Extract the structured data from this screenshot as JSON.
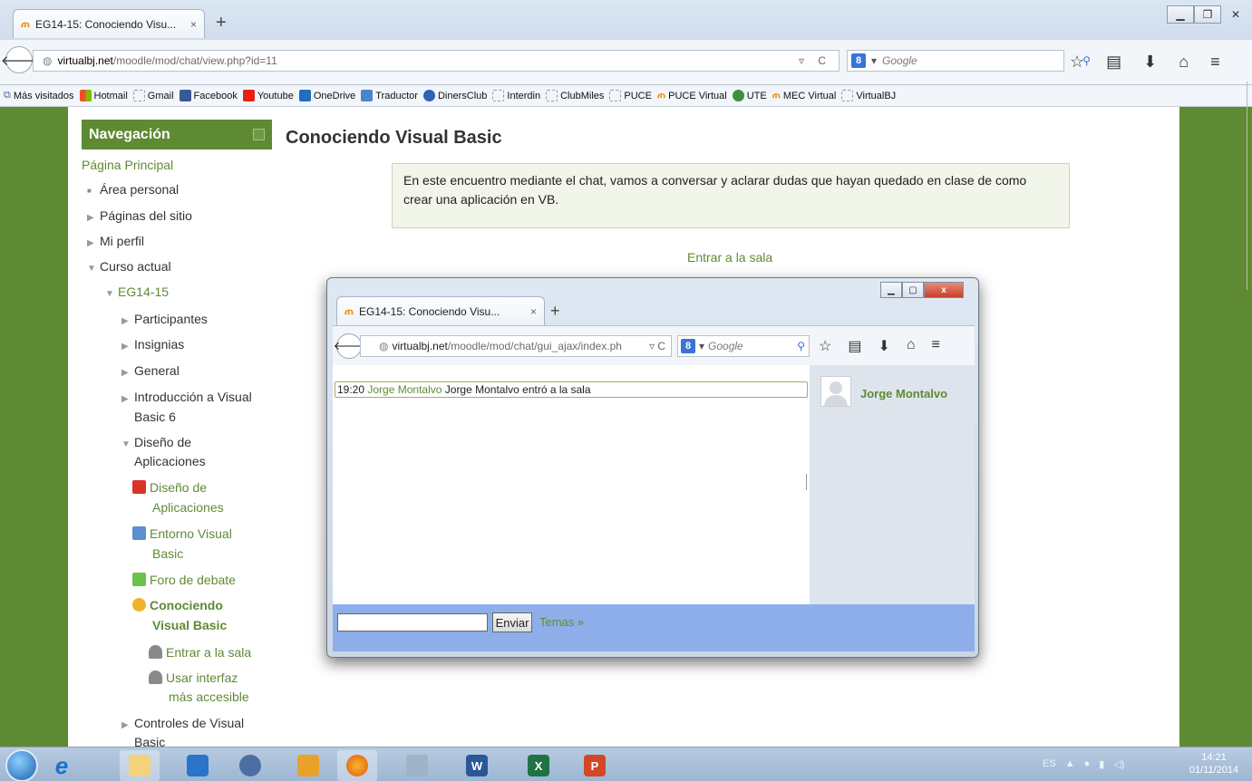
{
  "browser": {
    "tab_title": "EG14-15: Conociendo Visu...",
    "tab_close": "×",
    "new_tab": "+",
    "url_host": "virtualbj.net",
    "url_path": "/moodle/mod/chat/view.php?id=11",
    "search_placeholder": "Google",
    "bookmarks": [
      "Más visitados",
      "Hotmail",
      "Gmail",
      "Facebook",
      "Youtube",
      "OneDrive",
      "Traductor",
      "DinersClub",
      "Interdin",
      "ClubMiles",
      "PUCE",
      "PUCE Virtual",
      "UTE",
      "MEC Virtual",
      "VirtualBJ"
    ]
  },
  "nav": {
    "title": "Navegación",
    "items": [
      "Página Principal",
      "Área personal",
      "Páginas del sitio",
      "Mi perfil",
      "Curso actual",
      "EG14-15",
      "Participantes",
      "Insignias",
      "General",
      "Introducción a Visual",
      "Basic 6",
      "Diseño de",
      "Aplicaciones",
      "Diseño de",
      "Aplicaciones",
      "Entorno Visual",
      "Basic",
      "Foro de debate",
      "Conociendo",
      "Visual Basic",
      "Entrar a la sala",
      "Usar interfaz",
      "más accesible",
      "Controles de Visual",
      "Basic"
    ]
  },
  "main": {
    "title": "Conociendo Visual Basic",
    "intro_line1": "En este encuentro mediante el chat, vamos a conversar y aclarar dudas que hayan quedado en clase de como",
    "intro_line2": "crear una aplicación en VB.",
    "enter_link": "Entrar a la sala"
  },
  "popup": {
    "tab_title": "EG14-15: Conociendo Visu...",
    "tab_close": "×",
    "new_tab": "+",
    "url_host": "virtualbj.net",
    "url_path": "/moodle/mod/chat/gui_ajax/index.ph",
    "search_placeholder": "Google",
    "message": {
      "time": "19:20",
      "user": "Jorge Montalvo",
      "text": "Jorge Montalvo entró a la sala"
    },
    "users": [
      "Jorge Montalvo"
    ],
    "send_label": "Enviar",
    "topics_label": "Temas »",
    "close_glyph": "x"
  },
  "taskbar": {
    "lang": "ES",
    "time": "14:21",
    "date": "01/11/2014"
  },
  "colors": {
    "moodle_green": "#5f8a34",
    "intro_bg": "#f1f5ea",
    "chat_input_bar": "#8eaeea"
  }
}
